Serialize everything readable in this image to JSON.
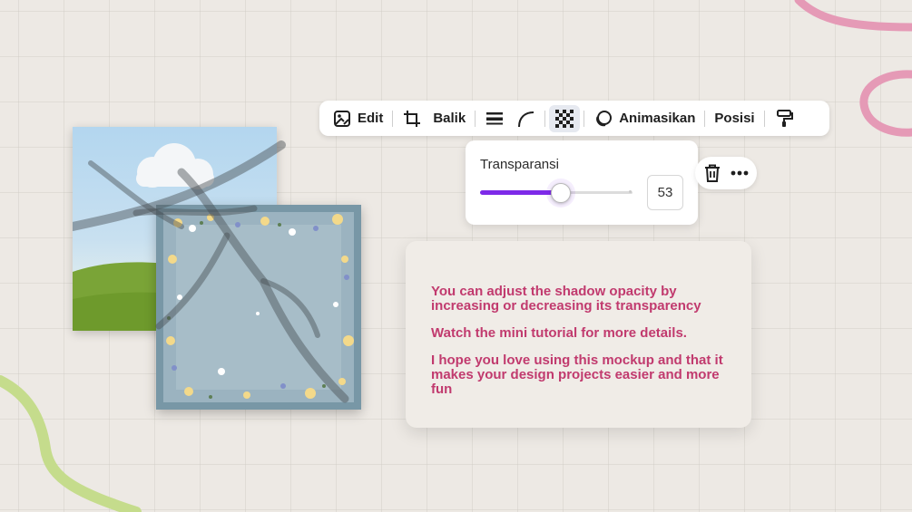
{
  "toolbar": {
    "items": [
      {
        "label": "Edit",
        "icon": "image-edit-icon"
      },
      {
        "label": "Balik",
        "icon": "crop-icon"
      },
      {
        "label": "",
        "icon": "border-style-icon"
      },
      {
        "label": "",
        "icon": "corner-rounding-icon"
      },
      {
        "label": "",
        "icon": "transparency-icon",
        "active": true
      },
      {
        "label": "Animasikan",
        "icon": "animate-icon"
      },
      {
        "label": "Posisi",
        "icon": ""
      },
      {
        "label": "",
        "icon": "paint-roller-icon"
      }
    ]
  },
  "transparency": {
    "label": "Transparansi",
    "value": "53",
    "level": 0.53,
    "accent": "#7d2ae8"
  },
  "element_actions": {
    "icons": [
      "trash-icon",
      "more-icon"
    ]
  },
  "note": {
    "color": "#c13a6e",
    "lines": [
      "You can adjust the shadow opacity by increasing or decreasing its transparency",
      "Watch the mini tutorial for more details.",
      "I hope you love using this mockup and that it makes your design projects easier and more fun"
    ]
  },
  "canvas": {
    "background": "#ede9e4",
    "decor_pink": "#e59ab6",
    "decor_green": "#c5dc8c"
  }
}
